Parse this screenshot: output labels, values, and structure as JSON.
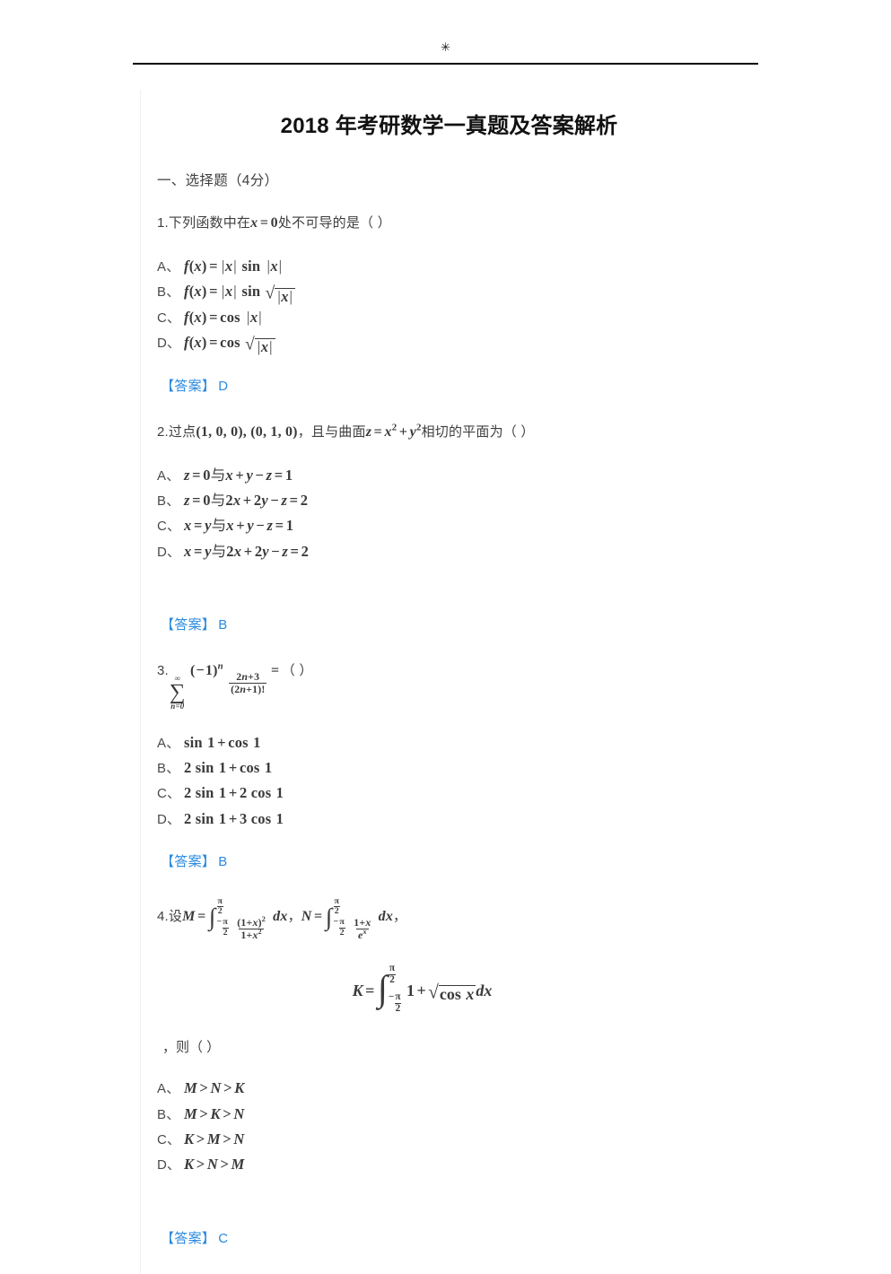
{
  "header": {
    "mark_icon": "asterisk-icon",
    "mark_glyph": "✳"
  },
  "document": {
    "title": "2018 年考研数学一真题及答案解析",
    "section_heading": "一、选择题（4分）",
    "answer_label": "【答案】",
    "answer_color": "#2a8ae0",
    "questions": [
      {
        "number": "1.",
        "stem_prefix": "下列函数中在",
        "stem_math": "x = 0",
        "stem_suffix": "处不可导的是（ ）",
        "options": [
          {
            "letter": "A、",
            "math": "f(x) = |x| sin |x|"
          },
          {
            "letter": "B、",
            "math": "f(x) = |x| sin √|x|"
          },
          {
            "letter": "C、",
            "math": "f(x) = cos |x|"
          },
          {
            "letter": "D、",
            "math": "f(x) = cos √|x|"
          }
        ],
        "answer": "D"
      },
      {
        "number": "2.",
        "stem_prefix": "过点",
        "stem_math": "(1, 0, 0), (0, 1, 0)",
        "stem_mid": "，且与曲面",
        "stem_math2": "z = x² + y²",
        "stem_suffix": "相切的平面为（ ）",
        "options": [
          {
            "letter": "A、",
            "math": "z = 0 与 x + y − z = 1"
          },
          {
            "letter": "B、",
            "math": "z = 0 与 2x + 2y − z = 2"
          },
          {
            "letter": "C、",
            "math": "x = y 与 x + y − z = 1"
          },
          {
            "letter": "D、",
            "math": "x = y 与 2x + 2y − z = 2"
          }
        ],
        "answer": "B"
      },
      {
        "number": "3.",
        "stem_math": "∑(n=0 to ∞) (−1)^n (2n+3)/((2n+1)!) = （ ）",
        "options": [
          {
            "letter": "A、",
            "math": "sin 1 + cos 1"
          },
          {
            "letter": "B、",
            "math": "2 sin 1 + cos 1"
          },
          {
            "letter": "C、",
            "math": "2 sin 1 + 2 cos 1"
          },
          {
            "letter": "D、",
            "math": "2 sin 1 + 3 cos 1"
          }
        ],
        "answer": "B"
      },
      {
        "number": "4.",
        "stem_prefix": "设",
        "stem_math_M": "M = ∫ from −π/2 to π/2 of (1+x)²/(1+x²) dx",
        "stem_sep": "，",
        "stem_math_N": "N = ∫ from −π/2 to π/2 of (1+x)/e^x dx",
        "stem_sep2": "，",
        "display_math_K": "K = ∫ from −π/2 to π/2 of 1 + √(cos x) dx",
        "stem_tail": "，则（ ）",
        "options": [
          {
            "letter": "A、",
            "math": "M > N > K"
          },
          {
            "letter": "B、",
            "math": "M > K > N"
          },
          {
            "letter": "C、",
            "math": "K > M > N"
          },
          {
            "letter": "D、",
            "math": "K > N > M"
          }
        ],
        "answer": "C"
      }
    ]
  }
}
